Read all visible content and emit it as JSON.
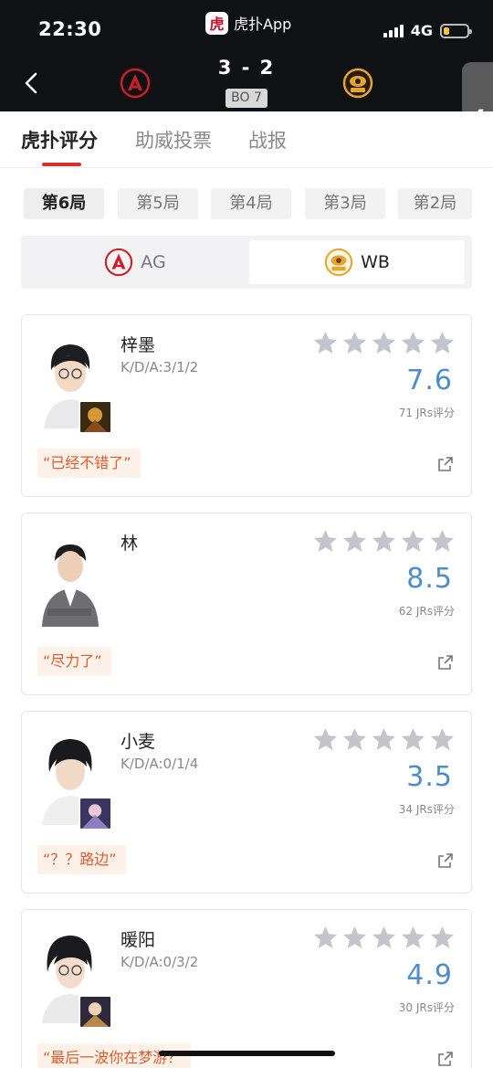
{
  "status_bar": {
    "time": "22:30",
    "app_name": "虎扑App",
    "app_logo_char": "虎",
    "network": "4G",
    "battery_level": 0.25
  },
  "match": {
    "score": "3 - 2",
    "format": "BO 7",
    "home_team": "AG",
    "away_team": "WB"
  },
  "tabs": [
    {
      "label": "虎扑评分",
      "active": true
    },
    {
      "label": "助威投票",
      "active": false
    },
    {
      "label": "战报",
      "active": false
    }
  ],
  "rounds": [
    {
      "label": "第6局",
      "active": true
    },
    {
      "label": "第5局",
      "active": false
    },
    {
      "label": "第4局",
      "active": false
    },
    {
      "label": "第3局",
      "active": false
    },
    {
      "label": "第2局",
      "active": false
    }
  ],
  "team_toggle": {
    "left_label": "AG",
    "right_label": "WB",
    "selected": "WB"
  },
  "players": [
    {
      "name": "梓墨",
      "kda": "K/D/A:3/1/2",
      "rating": "7.6",
      "count": "71 JRs评分",
      "quote": "“已经不错了”",
      "stars": 0
    },
    {
      "name": "林",
      "kda": "",
      "rating": "8.5",
      "count": "62 JRs评分",
      "quote": "“尽力了”",
      "stars": 0
    },
    {
      "name": "小麦",
      "kda": "K/D/A:0/1/4",
      "rating": "3.5",
      "count": "34 JRs评分",
      "quote": "“？？路边”",
      "stars": 0
    },
    {
      "name": "暖阳",
      "kda": "K/D/A:0/3/2",
      "rating": "4.9",
      "count": "30 JRs评分",
      "quote": "“最后一波你在梦游？",
      "stars": 0
    }
  ],
  "colors": {
    "accent_red": "#d9302c",
    "rating_blue": "#4b8ec9",
    "quote_orange": "#e05a2b",
    "star_gray": "#c4c4cc"
  }
}
